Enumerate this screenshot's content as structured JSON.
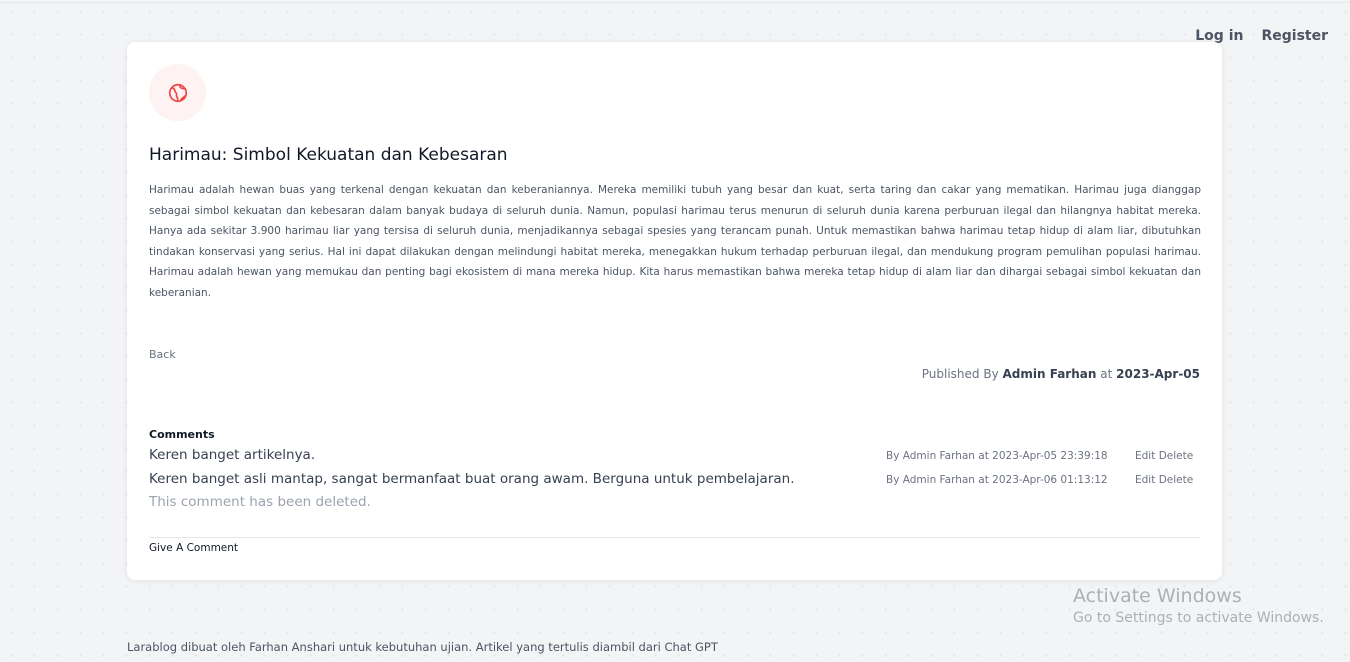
{
  "nav": {
    "login_label": "Log in",
    "register_label": "Register"
  },
  "article": {
    "icon": "globe-icon",
    "accent_color": "#ef4444",
    "title": "Harimau: Simbol Kekuatan dan Kebesaran",
    "body": "Harimau adalah hewan buas yang terkenal dengan kekuatan dan keberaniannya. Mereka memiliki tubuh yang besar dan kuat, serta taring dan cakar yang mematikan. Harimau juga dianggap sebagai simbol kekuatan dan kebesaran dalam banyak budaya di seluruh dunia. Namun, populasi harimau terus menurun di seluruh dunia karena perburuan ilegal dan hilangnya habitat mereka. Hanya ada sekitar 3.900 harimau liar yang tersisa di seluruh dunia, menjadikannya sebagai spesies yang terancam punah. Untuk memastikan bahwa harimau tetap hidup di alam liar, dibutuhkan tindakan konservasi yang serius. Hal ini dapat dilakukan dengan melindungi habitat mereka, menegakkan hukum terhadap perburuan ilegal, dan mendukung program pemulihan populasi harimau. Harimau adalah hewan yang memukau dan penting bagi ekosistem di mana mereka hidup. Kita harus memastikan bahwa mereka tetap hidup di alam liar dan dihargai sebagai simbol kekuatan dan keberanian.",
    "back_label": "Back",
    "published_prefix": "Published By",
    "author": "Admin Farhan",
    "published_at_word": "at",
    "published_date": "2023-Apr-05"
  },
  "comments": {
    "heading": "Comments",
    "items": [
      {
        "text": "Keren banget artikelnya.",
        "meta": "By Admin Farhan at 2023-Apr-05 23:39:18",
        "edit_label": "Edit",
        "delete_label": "Delete"
      },
      {
        "text": "Keren banget asli mantap, sangat bermanfaat buat orang awam. Berguna untuk pembelajaran.",
        "meta": "By Admin Farhan at 2023-Apr-06 01:13:12",
        "edit_label": "Edit",
        "delete_label": "Delete"
      }
    ],
    "deleted_text": "This comment has been deleted.",
    "give_comment_label": "Give A Comment"
  },
  "watermark": {
    "title": "Activate Windows",
    "subtitle": "Go to Settings to activate Windows."
  },
  "footer": {
    "text": "Larablog dibuat oleh Farhan Anshari untuk kebutuhan ujian. Artikel yang tertulis diambil dari Chat GPT"
  }
}
